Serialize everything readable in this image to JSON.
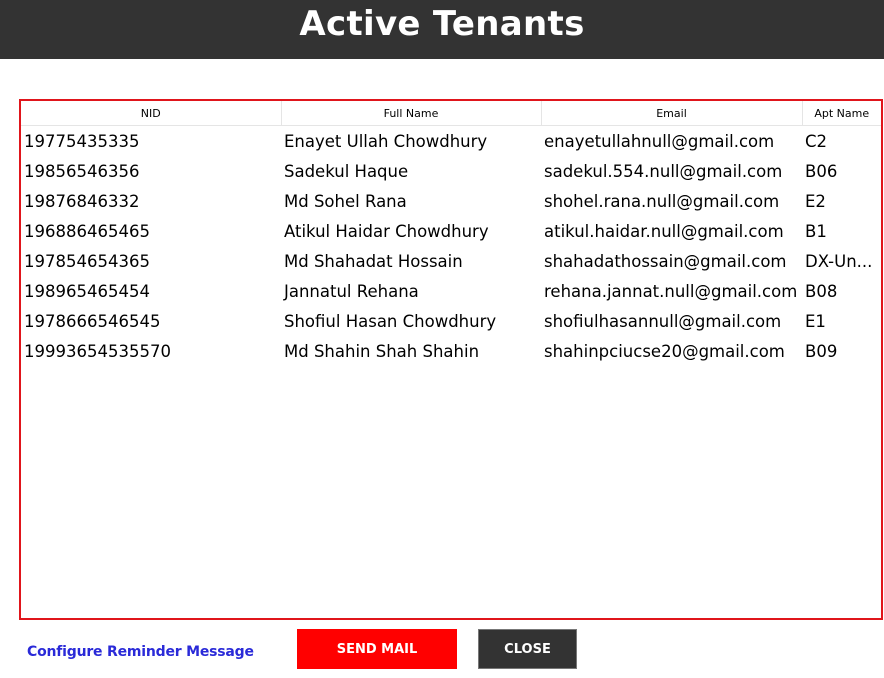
{
  "header": {
    "title": "Active Tenants"
  },
  "table": {
    "columns": [
      "NID",
      "Full Name",
      "Email",
      "Apt Name"
    ],
    "rows": [
      [
        "19775435335",
        "Enayet Ullah Chowdhury",
        "enayetullahnull@gmail.com",
        "C2"
      ],
      [
        "19856546356",
        "Sadekul Haque",
        "sadekul.554.null@gmail.com",
        "B06"
      ],
      [
        "19876846332",
        "Md Sohel Rana",
        "shohel.rana.null@gmail.com",
        "E2"
      ],
      [
        "196886465465",
        "Atikul Haidar Chowdhury",
        "atikul.haidar.null@gmail.com",
        "B1"
      ],
      [
        "197854654365",
        "Md Shahadat Hossain",
        "shahadathossain@gmail.com",
        "DX-Un..."
      ],
      [
        "198965465454",
        "Jannatul Rehana",
        "rehana.jannat.null@gmail.com",
        "B08"
      ],
      [
        "1978666546545",
        "Shofiul Hasan Chowdhury",
        "shofiulhasannull@gmail.com",
        "E1"
      ],
      [
        "19993654535570",
        "Md Shahin Shah Shahin",
        "shahinpciucse20@gmail.com",
        "B09"
      ]
    ]
  },
  "footer": {
    "config_link": "Configure Reminder Message",
    "send_label": "SEND MAIL",
    "close_label": "CLOSE"
  },
  "colors": {
    "header_bg": "#333333",
    "table_border": "#e0151b",
    "send_button": "#ff0000",
    "close_button": "#333333",
    "link": "#2a2ad8"
  }
}
